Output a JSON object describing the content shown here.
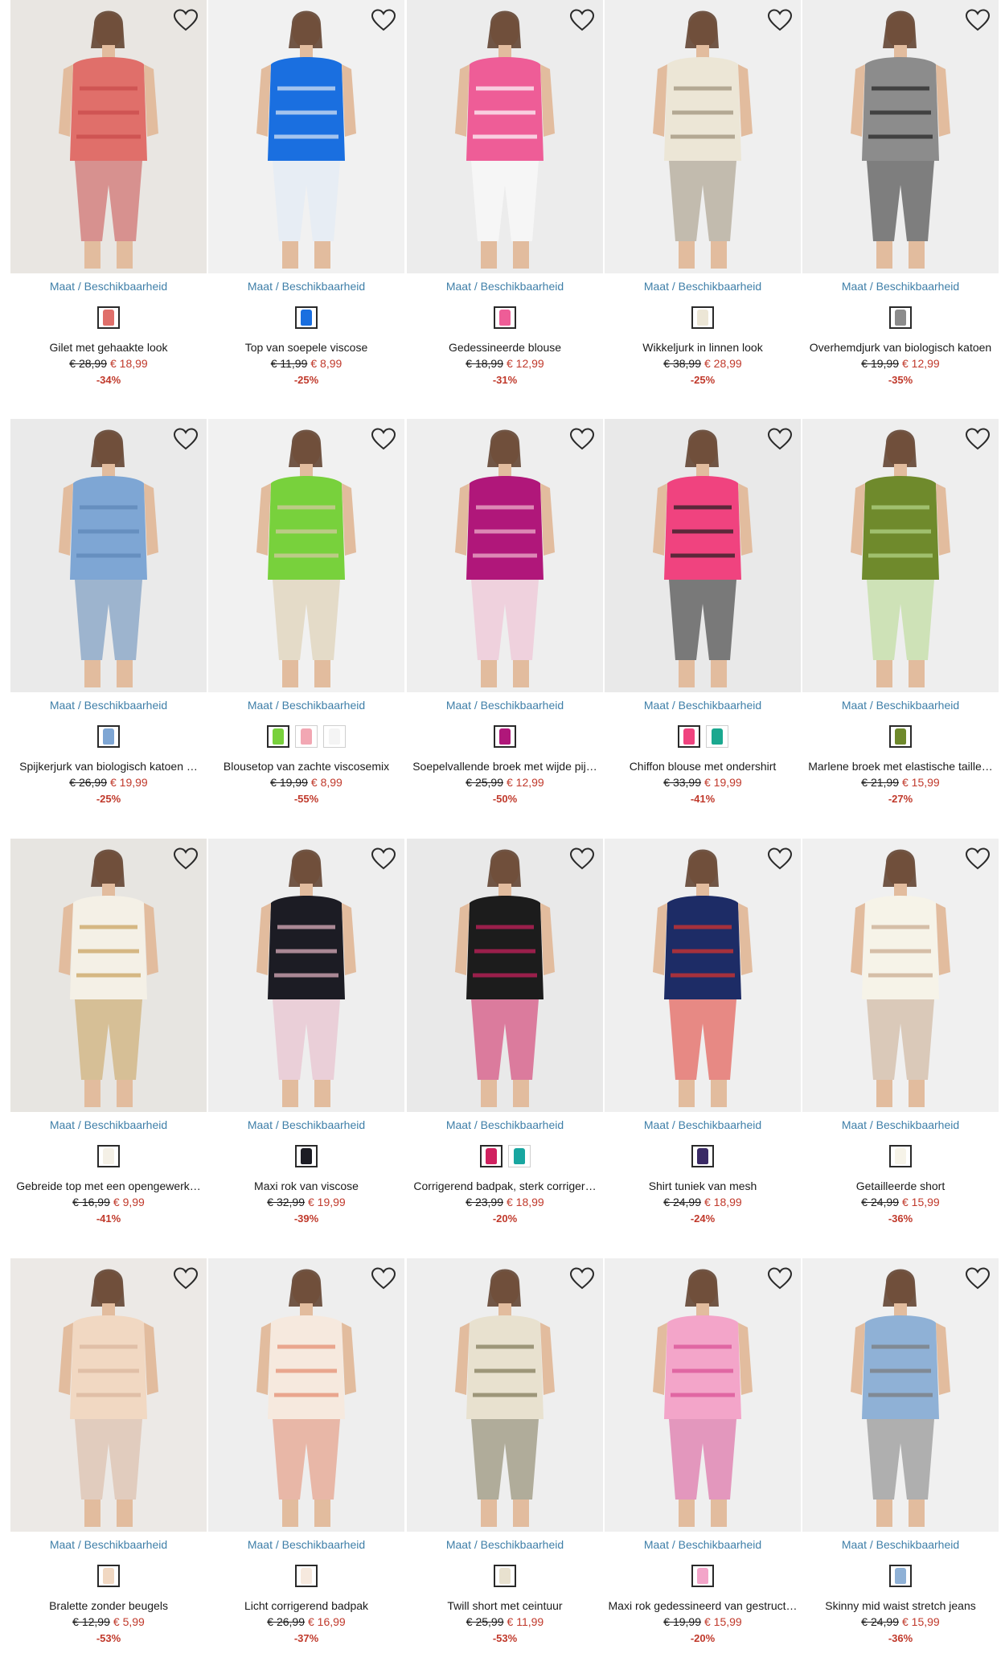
{
  "size_label": "Maat / Beschikbaarheid",
  "colors": {
    "link": "#3f7fa8",
    "sale": "#c0392b",
    "text": "#1a1a1a"
  },
  "products": [
    {
      "name": "Gilet met gehaakte look",
      "old_price": "€ 28,99",
      "new_price": "€ 18,99",
      "discount": "-34%",
      "bg": "#e9e6e2",
      "main": "#e06f6a",
      "accent": "#c94a4a",
      "swatches": [
        "#e06f6a"
      ]
    },
    {
      "name": "Top van soepele viscose",
      "old_price": "€ 11,99",
      "new_price": "€ 8,99",
      "discount": "-25%",
      "bg": "#f1f1f1",
      "main": "#1a6fe0",
      "accent": "#dfe9f5",
      "swatches": [
        "#1a6fe0"
      ]
    },
    {
      "name": "Gedessineerde blouse",
      "old_price": "€ 18,99",
      "new_price": "€ 12,99",
      "discount": "-31%",
      "bg": "#ececec",
      "main": "#ee5d97",
      "accent": "#ffffff",
      "swatches": [
        "#ee5d97"
      ]
    },
    {
      "name": "Wikkeljurk in linnen look",
      "old_price": "€ 38,99",
      "new_price": "€ 28,99",
      "discount": "-25%",
      "bg": "#efefef",
      "main": "#ece6d6",
      "accent": "#9c8f78",
      "swatches": [
        "#ece6d6"
      ]
    },
    {
      "name": "Overhemdjurk van biologisch katoen",
      "old_price": "€ 19,99",
      "new_price": "€ 12,99",
      "discount": "-35%",
      "bg": "#eeeeee",
      "main": "#8c8c8c",
      "accent": "#222222",
      "swatches": [
        "#8c8c8c"
      ]
    },
    {
      "name": "Spijkerjurk van biologisch katoen …",
      "old_price": "€ 26,99",
      "new_price": "€ 19,99",
      "discount": "-25%",
      "bg": "#eaeaea",
      "main": "#7ea6d4",
      "accent": "#5c86b7",
      "swatches": [
        "#7ea6d4"
      ]
    },
    {
      "name": "Blousetop van zachte viscosemix",
      "old_price": "€ 19,99",
      "new_price": "€ 8,99",
      "discount": "-55%",
      "bg": "#f1f1f1",
      "main": "#78d13c",
      "accent": "#d9c9a6",
      "swatches": [
        "#78d13c",
        "#f2a7b3",
        "#f4f4f4"
      ]
    },
    {
      "name": "Soepelvallende broek met wijde pij…",
      "old_price": "€ 25,99",
      "new_price": "€ 12,99",
      "discount": "-50%",
      "bg": "#eeeeee",
      "main": "#b0177a",
      "accent": "#f1b9cf",
      "swatches": [
        "#b0177a"
      ]
    },
    {
      "name": "Chiffon blouse met ondershirt",
      "old_price": "€ 33,99",
      "new_price": "€ 19,99",
      "discount": "-41%",
      "bg": "#e9e9e9",
      "main": "#f0437f",
      "accent": "#1e1e1e",
      "swatches": [
        "#f0437f",
        "#1aa88f"
      ]
    },
    {
      "name": "Marlene broek met elastische taille…",
      "old_price": "€ 21,99",
      "new_price": "€ 15,99",
      "discount": "-27%",
      "bg": "#eeeeee",
      "main": "#6f8a2c",
      "accent": "#b5d88a",
      "swatches": [
        "#6f8a2c"
      ]
    },
    {
      "name": "Gebreide top met een opengewerk…",
      "old_price": "€ 16,99",
      "new_price": "€ 9,99",
      "discount": "-41%",
      "bg": "#e7e5e1",
      "main": "#f4f0e6",
      "accent": "#c8a05a",
      "swatches": [
        "#f4f0e6"
      ]
    },
    {
      "name": "Maxi rok van viscose",
      "old_price": "€ 32,99",
      "new_price": "€ 19,99",
      "discount": "-39%",
      "bg": "#eeeeee",
      "main": "#1c1c24",
      "accent": "#e7b7c6",
      "swatches": [
        "#1c1c24"
      ]
    },
    {
      "name": "Corrigerend badpak, sterk corriger…",
      "old_price": "€ 23,99",
      "new_price": "€ 18,99",
      "discount": "-20%",
      "bg": "#e9e9e9",
      "main": "#1c1c1c",
      "accent": "#d0215f",
      "swatches": [
        "#d0215f",
        "#18a6a0"
      ]
    },
    {
      "name": "Shirt tuniek van mesh",
      "old_price": "€ 24,99",
      "new_price": "€ 18,99",
      "discount": "-24%",
      "bg": "#efefef",
      "main": "#1d2c66",
      "accent": "#e0342b",
      "swatches": [
        "#3a2a66"
      ]
    },
    {
      "name": "Getailleerde short",
      "old_price": "€ 24,99",
      "new_price": "€ 15,99",
      "discount": "-36%",
      "bg": "#f0f0f0",
      "main": "#f6f3e8",
      "accent": "#c8a98c",
      "swatches": [
        "#f6f3e8"
      ]
    },
    {
      "name": "Bralette zonder beugels",
      "old_price": "€ 12,99",
      "new_price": "€ 5,99",
      "discount": "-53%",
      "bg": "#ece9e6",
      "main": "#f1d8c2",
      "accent": "#d9b59c",
      "swatches": [
        "#f1d8c2"
      ]
    },
    {
      "name": "Licht corrigerend badpak",
      "old_price": "€ 26,99",
      "new_price": "€ 16,99",
      "discount": "-37%",
      "bg": "#eeeeee",
      "main": "#f6e9de",
      "accent": "#e48a6d",
      "swatches": [
        "#f6e9de"
      ]
    },
    {
      "name": "Twill short met ceintuur",
      "old_price": "€ 25,99",
      "new_price": "€ 11,99",
      "discount": "-53%",
      "bg": "#eeeeee",
      "main": "#e8e1cf",
      "accent": "#7e7755",
      "swatches": [
        "#e8e1cf"
      ]
    },
    {
      "name": "Maxi rok gedessineerd van gestruct…",
      "old_price": "€ 19,99",
      "new_price": "€ 15,99",
      "discount": "-20%",
      "bg": "#efefef",
      "main": "#f3a5c9",
      "accent": "#d94e93",
      "swatches": [
        "#f3a5c9"
      ]
    },
    {
      "name": "Skinny mid waist stretch jeans",
      "old_price": "€ 24,99",
      "new_price": "€ 15,99",
      "discount": "-36%",
      "bg": "#f0f0f0",
      "main": "#8fb1d6",
      "accent": "#7a7a7a",
      "swatches": [
        "#8fb1d6"
      ]
    }
  ]
}
